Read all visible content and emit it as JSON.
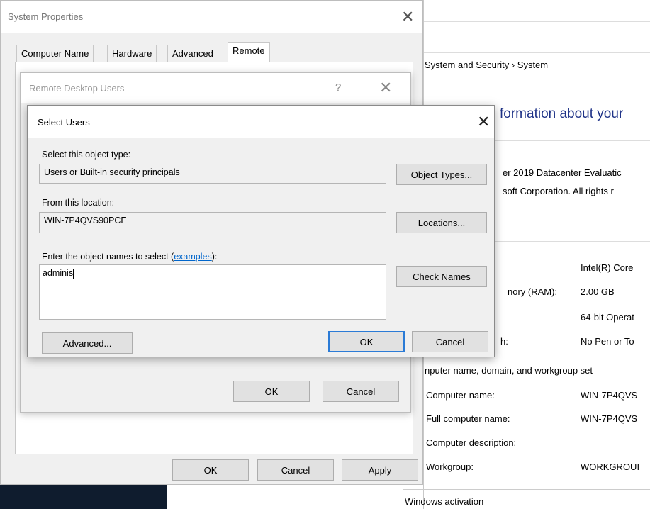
{
  "system_properties": {
    "title": "System Properties",
    "tabs": [
      {
        "label": "Computer Name"
      },
      {
        "label": "Hardware"
      },
      {
        "label": "Advanced"
      },
      {
        "label": "Remote"
      }
    ],
    "ok_label": "OK",
    "cancel_label": "Cancel",
    "apply_label": "Apply"
  },
  "remote_desktop_users": {
    "title": "Remote Desktop Users",
    "help_glyph": "?",
    "ok_label": "OK",
    "cancel_label": "Cancel"
  },
  "select_users": {
    "title": "Select Users",
    "object_type_label": "Select this object type:",
    "object_type_value": "Users or Built-in security principals",
    "object_types_button": "Object Types...",
    "location_label": "From this location:",
    "location_value": "WIN-7P4QVS90PCE",
    "locations_button": "Locations...",
    "names_label_prefix": "Enter the object names to select (",
    "names_label_link": "examples",
    "names_label_suffix": "):",
    "names_value": "adminis",
    "check_names_button": "Check Names",
    "advanced_button": "Advanced...",
    "ok_button": "OK",
    "cancel_button": "Cancel"
  },
  "system_panel": {
    "breadcrumb": "System and Security  ›  System",
    "heading": "formation about your",
    "edition_line": "er 2019 Datacenter Evaluatic",
    "copyright_line": "soft Corporation. All rights r",
    "processor_value": "Intel(R) Core",
    "memory_label": "nory (RAM):",
    "memory_value": "2.00 GB",
    "system_type_value": "64-bit Operat",
    "pen_label": "h:",
    "pen_value": "No Pen or To",
    "section_title": "nputer name, domain, and workgroup set",
    "computer_name_label": "Computer name:",
    "computer_name_value": "WIN-7P4QVS",
    "full_name_label": "Full computer name:",
    "full_name_value": "WIN-7P4QVS",
    "description_label": "Computer description:",
    "workgroup_label": "Workgroup:",
    "workgroup_value": "WORKGROUI",
    "activation_title": "Windows activation"
  },
  "colors": {
    "link": "#0066cc",
    "heading": "#1e3287",
    "focus": "#2b7bd6",
    "taskbar": "#0f1c2e"
  }
}
